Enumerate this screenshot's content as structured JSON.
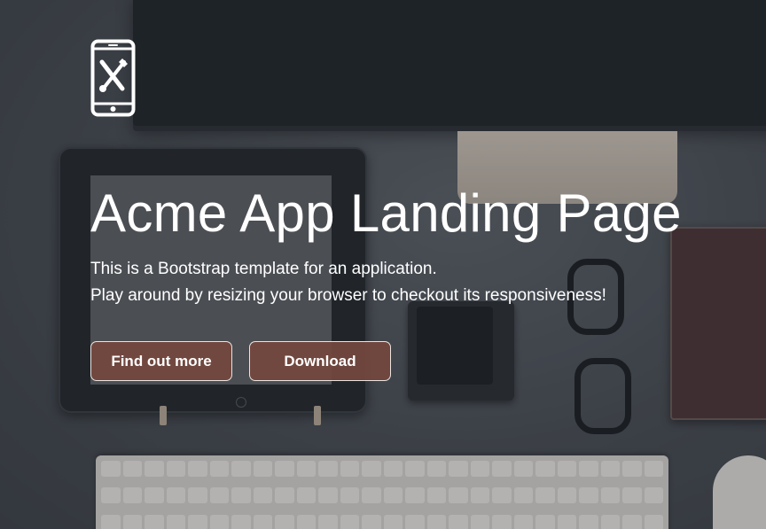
{
  "brand": {
    "icon": "mobile-app-tools-icon"
  },
  "hero": {
    "title": "Acme App Landing Page",
    "subtitle_line1": "This is a Bootstrap template for an application.",
    "subtitle_line2": "Play around by resizing your browser to checkout its responsiveness!"
  },
  "buttons": {
    "find_out_more": "Find out more",
    "download": "Download"
  },
  "colors": {
    "button_bg": "#74483e",
    "text": "#ffffff",
    "background": "#4a4f55"
  }
}
